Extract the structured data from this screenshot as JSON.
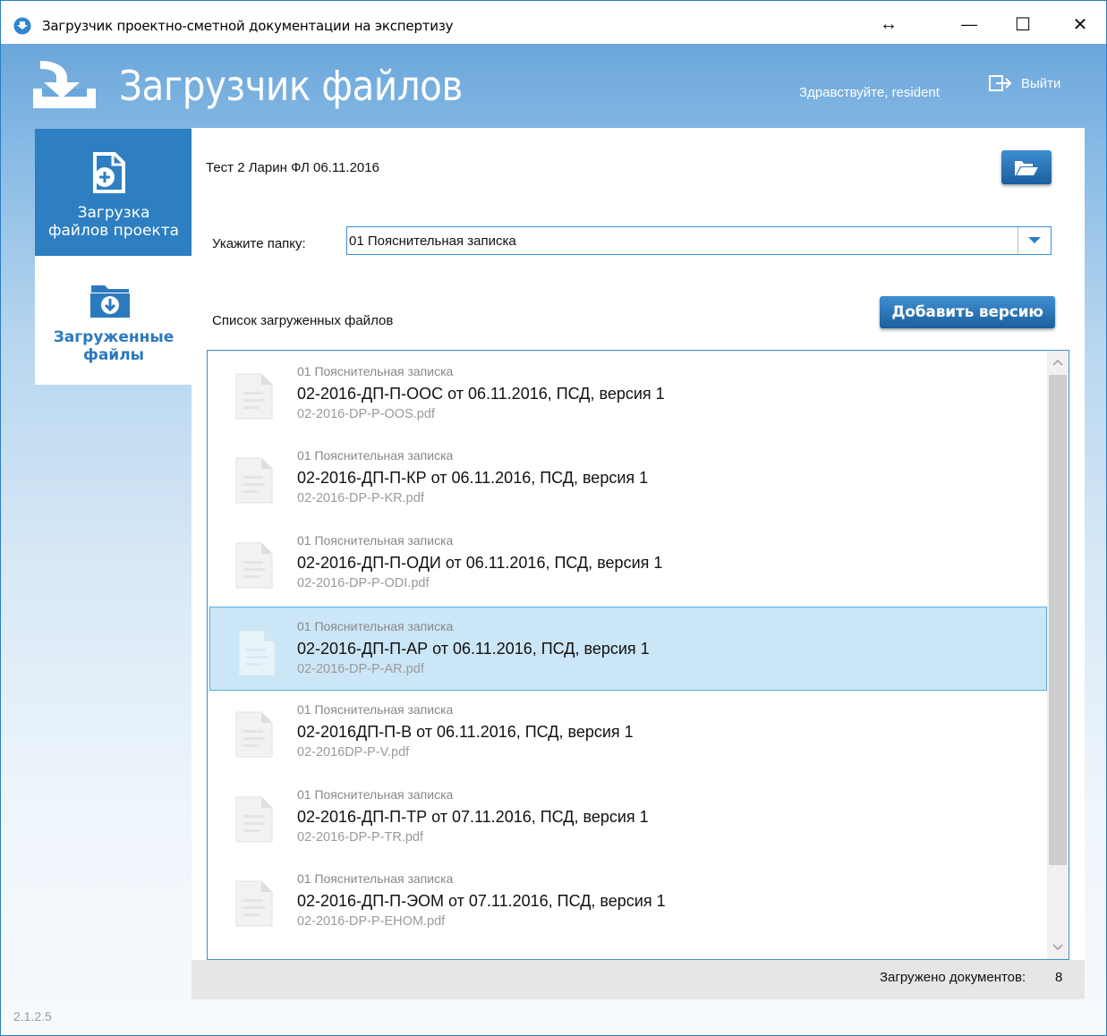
{
  "window": {
    "title": "Загрузчик проектно-сметной документации на экспертизу",
    "resize_glyph": "↔",
    "minimize_glyph": "—",
    "maximize_glyph": "☐",
    "close_glyph": "✕"
  },
  "header": {
    "title": "Загрузчик файлов",
    "greeting": "Здравствуйте, resident",
    "logout_label": "Выйти"
  },
  "sidebar": {
    "items": [
      {
        "line1": "Загрузка",
        "line2": "файлов проекта",
        "icon": "upload-file-icon",
        "active": true
      },
      {
        "line1": "Загруженные",
        "line2": "файлы",
        "icon": "download-folder-icon",
        "active": false
      }
    ]
  },
  "main": {
    "project_name": "Тест 2 Ларин ФЛ 06.11.2016",
    "folder_label": "Укажите папку:",
    "folder_value": "01 Пояснительная записка",
    "list_title": "Список загруженных файлов",
    "add_version_label": "Добавить версию",
    "files": [
      {
        "folder": "01 Пояснительная записка",
        "name": "02-2016-ДП-П-ООС от 06.11.2016, ПСД, версия 1",
        "filename": "02-2016-DP-P-OOS.pdf",
        "selected": false
      },
      {
        "folder": "01 Пояснительная записка",
        "name": "02-2016-ДП-П-КР от 06.11.2016, ПСД, версия 1",
        "filename": "02-2016-DP-P-KR.pdf",
        "selected": false
      },
      {
        "folder": "01 Пояснительная записка",
        "name": "02-2016-ДП-П-ОДИ от 06.11.2016, ПСД, версия 1",
        "filename": "02-2016-DP-P-ODI.pdf",
        "selected": false
      },
      {
        "folder": "01 Пояснительная записка",
        "name": "02-2016-ДП-П-АР от 06.11.2016, ПСД, версия 1",
        "filename": "02-2016-DP-P-AR.pdf",
        "selected": true
      },
      {
        "folder": "01 Пояснительная записка",
        "name": "02-2016ДП-П-В от 06.11.2016, ПСД, версия 1",
        "filename": "02-2016DP-P-V.pdf",
        "selected": false
      },
      {
        "folder": "01 Пояснительная записка",
        "name": "02-2016-ДП-П-ТР от 07.11.2016, ПСД, версия 1",
        "filename": "02-2016-DP-P-TR.pdf",
        "selected": false
      },
      {
        "folder": "01 Пояснительная записка",
        "name": "02-2016-ДП-П-ЭОМ от 07.11.2016, ПСД, версия 1",
        "filename": "02-2016-DP-P-EHOM.pdf",
        "selected": false
      }
    ],
    "doc_count_label": "Загружено документов:",
    "doc_count_value": "8"
  },
  "footer": {
    "version": "2.1.2.5"
  },
  "colors": {
    "accent": "#2e7fc1",
    "selection": "#cbe6f6"
  }
}
